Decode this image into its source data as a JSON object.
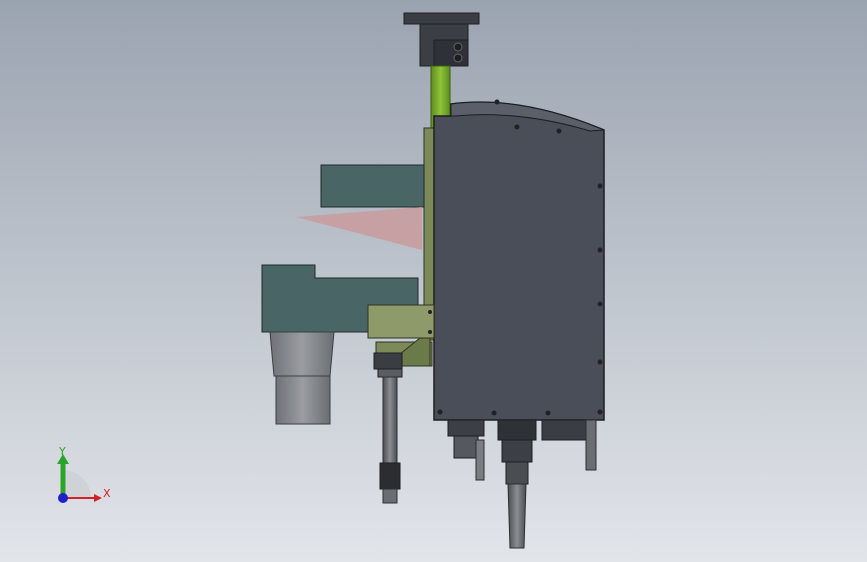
{
  "viewport": {
    "background_top": "#9aa3b0",
    "background_bottom": "#e2e5ea"
  },
  "colors": {
    "housing": "#4a4e58",
    "green_rail": "#79b12c",
    "olive_plate": "#7b8a58",
    "teal_block": "#4a6565",
    "laser_beam": "#c99ca0",
    "y_axis": "#2aa52a",
    "x_axis": "#d42020",
    "z_axis": "#2020c8"
  },
  "triad": {
    "x_label": "X",
    "y_label": "Y"
  }
}
